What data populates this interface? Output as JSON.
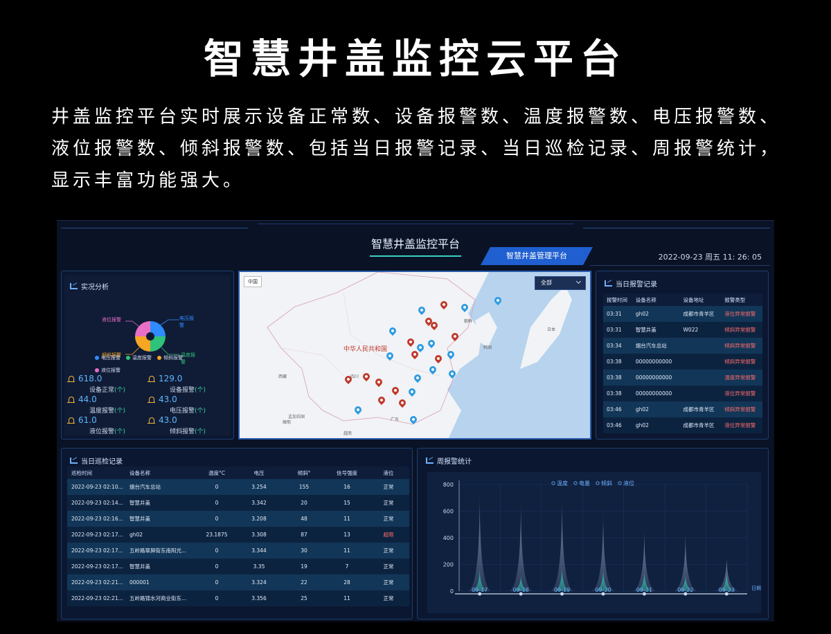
{
  "promo": {
    "title": "智慧井盖监控云平台",
    "description": "井盖监控平台实时展示设备正常数、设备报警数、温度报警数、电压报警数、液位报警数、倾斜报警数、包括当日报警记录、当日巡检记录、周报警统计，显示丰富功能强大。"
  },
  "header": {
    "title": "智慧井盖监控平台",
    "active_tab": "智慧井盖管理平台",
    "datetime": "2022-09-23 周五 11: 26: 05"
  },
  "stats": {
    "title": "实况分析",
    "donut_labels": {
      "top_left": "液位报警",
      "top_right": "电压报警",
      "bottom_left": "倾斜报警",
      "bottom_right": "温度报警"
    },
    "legend": [
      {
        "label": "电压报警",
        "color": "#2f8cff"
      },
      {
        "label": "温度报警",
        "color": "#2fc27a"
      },
      {
        "label": "倾斜报警",
        "color": "#f5a623"
      },
      {
        "label": "液位报警",
        "color": "#e86fc6"
      }
    ],
    "items": [
      {
        "value": "618.0",
        "label": "设备正常",
        "unit": "(个)"
      },
      {
        "value": "129.0",
        "label": "设备报警",
        "unit": "(个)"
      },
      {
        "value": "44.0",
        "label": "温度报警",
        "unit": "(个)"
      },
      {
        "value": "43.0",
        "label": "电压报警",
        "unit": "(个)"
      },
      {
        "value": "61.0",
        "label": "液位报警",
        "unit": "(个)"
      },
      {
        "value": "43.0",
        "label": "倾斜报警",
        "unit": "(个)"
      }
    ]
  },
  "map": {
    "region_select": "全部",
    "corner_label": "中国",
    "country_label": "中华人民共和国",
    "labels": [
      "朝鲜",
      "日本",
      "韩国",
      "越南",
      "缅甸",
      "孟加拉国",
      "西藏",
      "广东",
      "四川"
    ]
  },
  "alarms": {
    "title": "当日报警记录",
    "columns": [
      "报警时间",
      "设备名称",
      "设备地址",
      "报警类型"
    ],
    "rows": [
      [
        "03:31",
        "gh02",
        "成都市青羊区",
        "液位异常报警"
      ],
      [
        "03:31",
        "智慧井盖",
        "W022",
        "倾斜异常报警"
      ],
      [
        "03:34",
        "烟台汽车总站",
        "",
        "倾斜异常报警"
      ],
      [
        "03:38",
        "00000000000",
        "",
        "倾斜异常报警"
      ],
      [
        "03:38",
        "00000000000",
        "",
        "温度异常报警"
      ],
      [
        "03:38",
        "00000000000",
        "",
        "液位异常报警"
      ],
      [
        "03:46",
        "gh02",
        "成都市青羊区",
        "倾斜异常报警"
      ],
      [
        "03:46",
        "gh02",
        "成都市青羊区",
        "液位异常报警"
      ]
    ]
  },
  "patrol": {
    "title": "当日巡检记录",
    "columns": [
      "巡检时间",
      "设备名称",
      "温度°C",
      "电压",
      "倾斜°",
      "信号强度",
      "液位"
    ],
    "rows": [
      [
        "2022-09-23 02:10...",
        "烟台汽车总站",
        "0",
        "3.254",
        "155",
        "16",
        "正常"
      ],
      [
        "2022-09-23 02:14...",
        "智慧井盖",
        "0",
        "3.342",
        "20",
        "15",
        "正常"
      ],
      [
        "2022-09-23 02:16...",
        "智慧井盖",
        "0",
        "3.208",
        "48",
        "11",
        "正常"
      ],
      [
        "2022-09-23 02:17...",
        "gh02",
        "23.1875",
        "3.308",
        "87",
        "13",
        "超限"
      ],
      [
        "2022-09-23 02:17...",
        "五岭路翠屏街东南阳光...",
        "0",
        "3.344",
        "30",
        "11",
        "正常"
      ],
      [
        "2022-09-23 02:17...",
        "智慧井盖",
        "0",
        "3.35",
        "19",
        "7",
        "正常"
      ],
      [
        "2022-09-23 02:21...",
        "000001",
        "0",
        "3.324",
        "22",
        "28",
        "正常"
      ],
      [
        "2022-09-23 02:21...",
        "五岭路锦水河商业街东...",
        "0",
        "3.356",
        "25",
        "11",
        "正常"
      ]
    ]
  },
  "chart_data": {
    "type": "area",
    "title": "周报警统计",
    "xlabel": "日期",
    "categories": [
      "09-17",
      "09-18",
      "09-19",
      "09-20",
      "09-21",
      "09-22",
      "09-23"
    ],
    "ylim": [
      0,
      800
    ],
    "yticks": [
      0,
      200,
      400,
      600,
      800
    ],
    "legend": [
      "温度",
      "电量",
      "倾斜",
      "液位"
    ],
    "series": [
      {
        "name": "温度",
        "values": [
          730,
          670,
          700,
          590,
          460,
          440,
          260
        ]
      },
      {
        "name": "电量",
        "values": [
          170,
          115,
          180,
          170,
          150,
          120,
          140
        ]
      }
    ],
    "colors": {
      "温度": "#8a93b8",
      "电量": "#2fd6b6"
    }
  }
}
